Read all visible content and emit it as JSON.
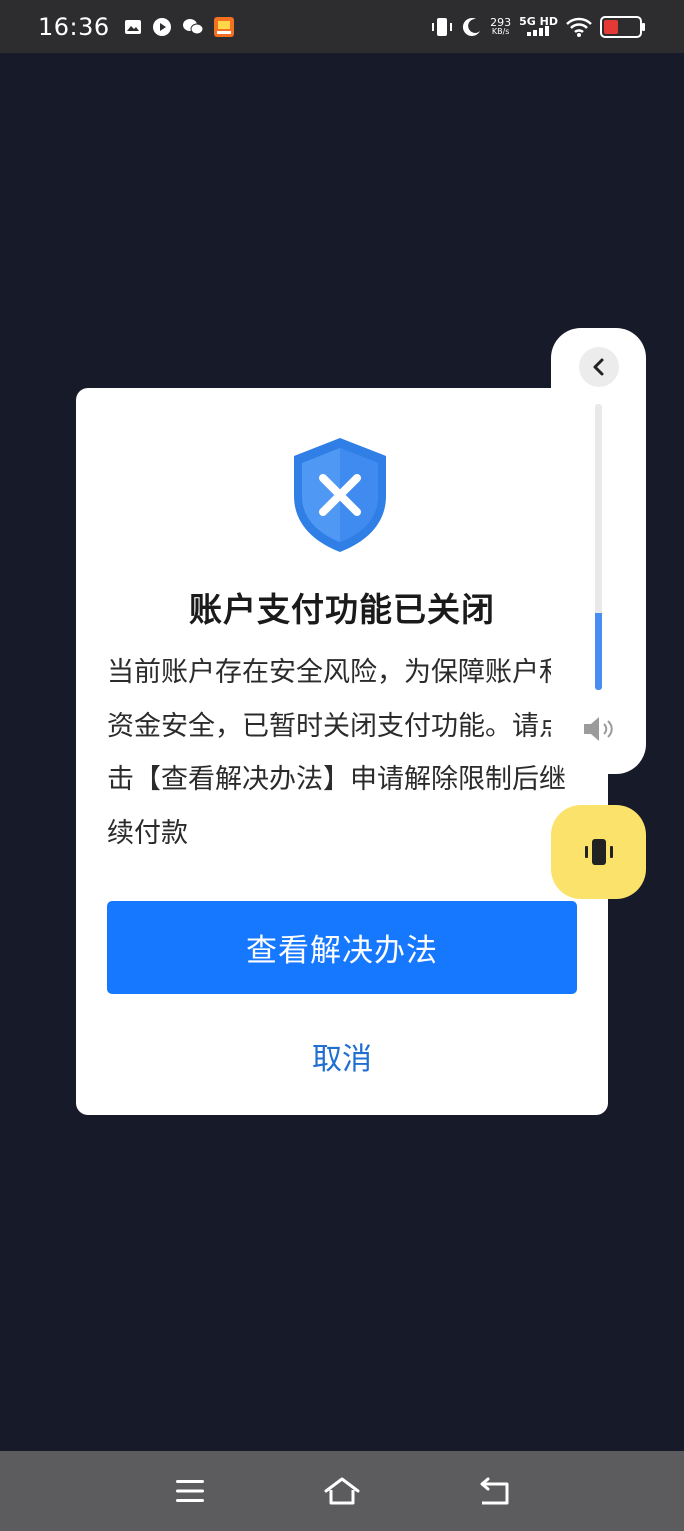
{
  "status_bar": {
    "time": "16:36",
    "net_speed_value": "293",
    "net_speed_unit": "KB/s",
    "signal_label": "5G HD",
    "battery_color": "#e53935",
    "left_icons": [
      "gallery-icon",
      "play-icon",
      "wechat-icon",
      "app-badge-icon"
    ],
    "right_icons": [
      "vibrate-mode-icon",
      "moon-icon",
      "signal-icon",
      "wifi-icon",
      "battery-icon"
    ]
  },
  "dialog": {
    "icon": "shield-x-icon",
    "title": "账户支付功能已关闭",
    "body": "当前账户存在安全风险，为保障账户和资金安全，已暂时关闭支付功能。请点击【查看解决办法】申请解除限制后继续付款",
    "primary_button": "查看解决办法",
    "cancel_button": "取消",
    "accent_color": "#1677ff"
  },
  "volume_panel": {
    "collapse_icon": "chevron-left-icon",
    "level": 0.27,
    "speaker_icon": "speaker-icon",
    "vibrate_icon": "vibrate-icon",
    "vibrate_color": "#fbe36b"
  },
  "nav_bar": {
    "icons": [
      "menu-icon",
      "home-icon",
      "back-icon"
    ]
  }
}
